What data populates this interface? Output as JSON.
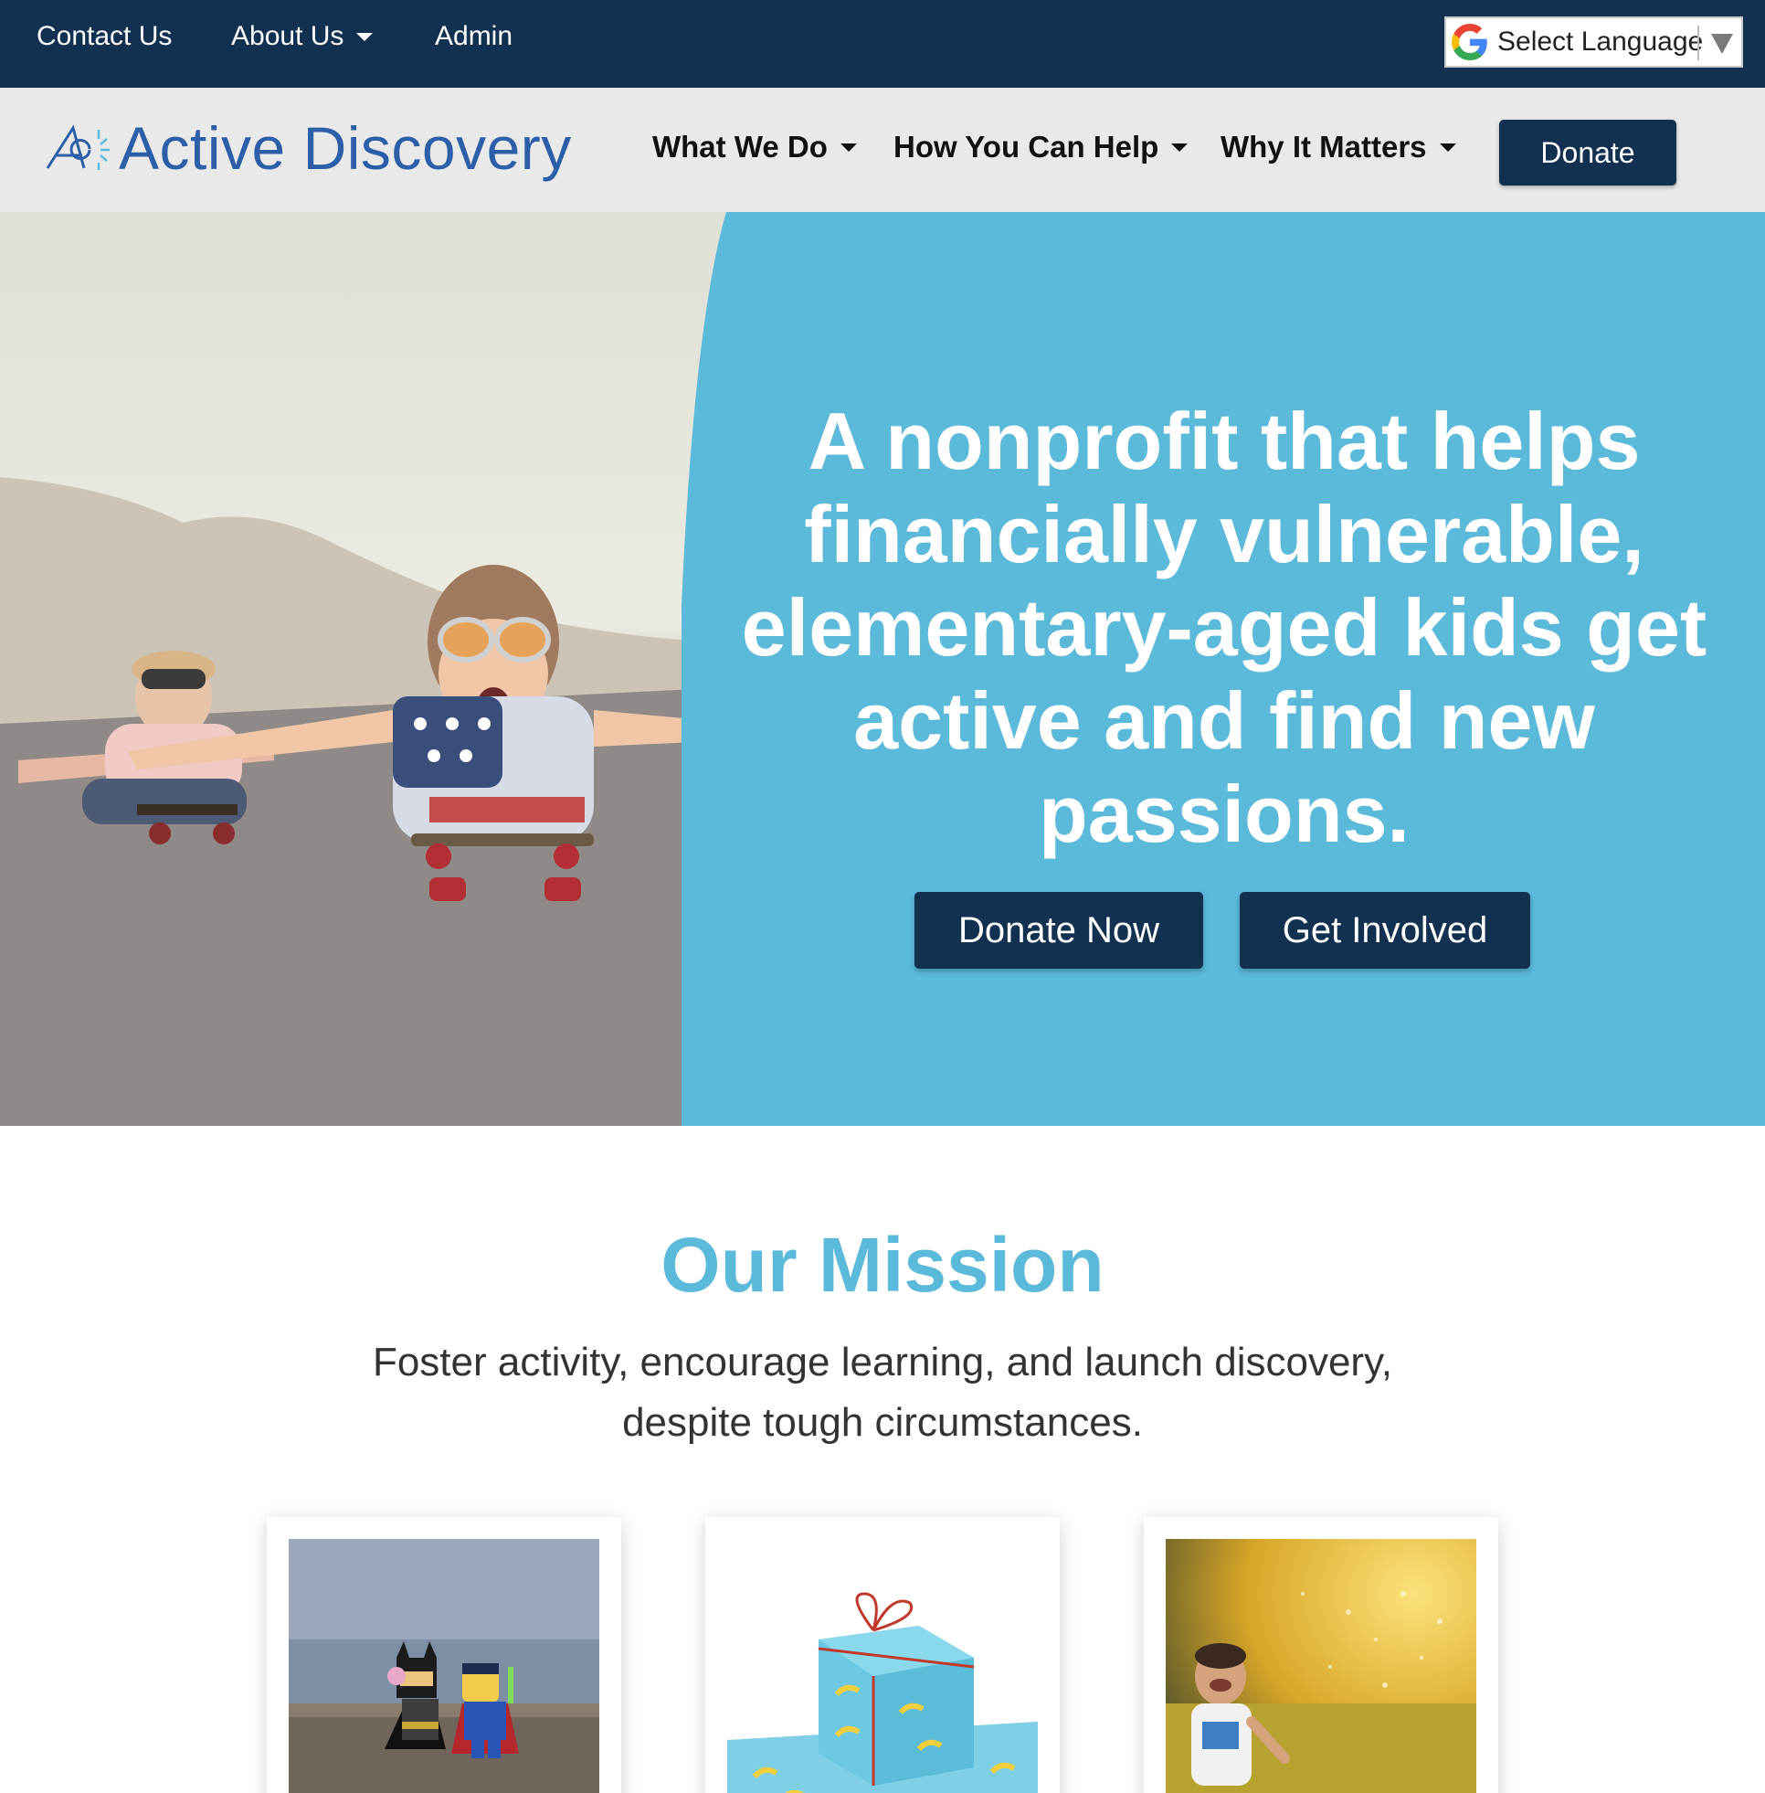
{
  "topbar": {
    "links": [
      {
        "label": "Contact Us"
      },
      {
        "label": "About Us"
      },
      {
        "label": "Admin"
      }
    ],
    "language": {
      "label": "Select Language",
      "icon": "google-icon"
    }
  },
  "nav": {
    "logo_text": "Active Discovery",
    "items": [
      {
        "label": "What We Do"
      },
      {
        "label": "How You Can Help"
      },
      {
        "label": "Why It Matters"
      }
    ],
    "donate_label": "Donate"
  },
  "hero": {
    "headline": "A nonprofit that helps financially vulnerable, elementary-aged kids get active and find new passions.",
    "buttons": {
      "donate_now": "Donate Now",
      "get_involved": "Get Involved"
    }
  },
  "mission": {
    "title": "Our Mission",
    "text": "Foster activity, encourage learning, and launch discovery, despite tough circumstances."
  },
  "colors": {
    "navy": "#12304f",
    "sky": "#5bb9da",
    "brand_blue": "#2d5fa8",
    "nav_bg": "#e9e9e9"
  }
}
